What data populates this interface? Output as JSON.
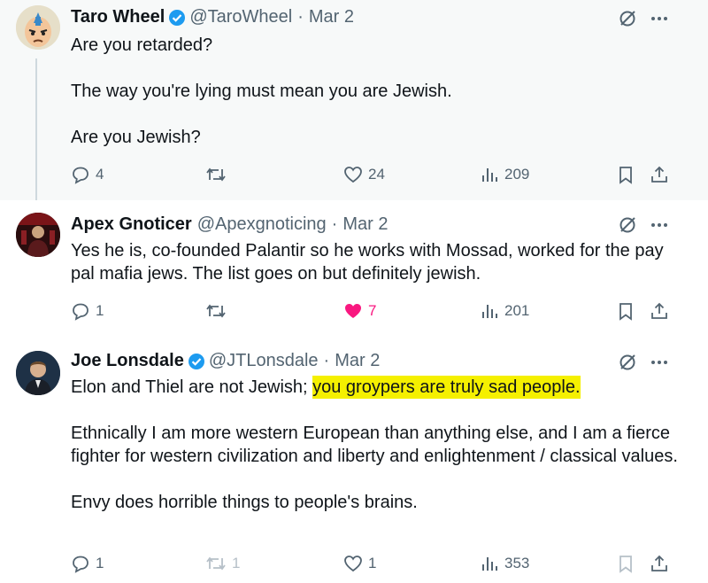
{
  "tweets": [
    {
      "name": "Taro Wheel",
      "handle": "@TaroWheel",
      "separator": "·",
      "date": "Mar 2",
      "paragraphs": [
        "Are you retarded?",
        "The way you're lying must mean you are Jewish.",
        "Are you Jewish?"
      ],
      "replies": "4",
      "retweets": "",
      "likes": "24",
      "views": "209",
      "liked": false
    },
    {
      "name": "Apex Gnoticer",
      "handle": "@Apexgnoticing",
      "separator": "·",
      "date": "Mar 2",
      "paragraphs": [
        "Yes he is, co-founded Palantir so he works with Mossad, worked for the pay pal mafia jews. The list goes on but definitely jewish."
      ],
      "replies": "1",
      "retweets": "",
      "likes": "7",
      "views": "201",
      "liked": true
    },
    {
      "name": "Joe Lonsdale",
      "handle": "@JTLonsdale",
      "separator": "·",
      "date": "Mar 2",
      "p1_plain": "Elon and Thiel are not Jewish; ",
      "p1_highlight": "you groypers are truly sad people.",
      "paragraphs": [
        "Ethnically I am more western European than anything else, and I am a fierce fighter for western civilization and liberty and enlightenment / classical values.",
        "Envy does horrible things to people's brains."
      ],
      "replies": "1",
      "retweets": "1",
      "likes": "1",
      "views": "353",
      "liked": false
    }
  ],
  "colors": {
    "verified": "#1d9bf0",
    "like": "#f91880",
    "highlight": "#f5f000",
    "muted": "#536471"
  },
  "icons": [
    "verified-badge-icon",
    "grok-slash-icon",
    "more-dots-icon",
    "reply-icon",
    "retweet-icon",
    "like-icon",
    "views-icon",
    "bookmark-icon",
    "share-icon"
  ]
}
